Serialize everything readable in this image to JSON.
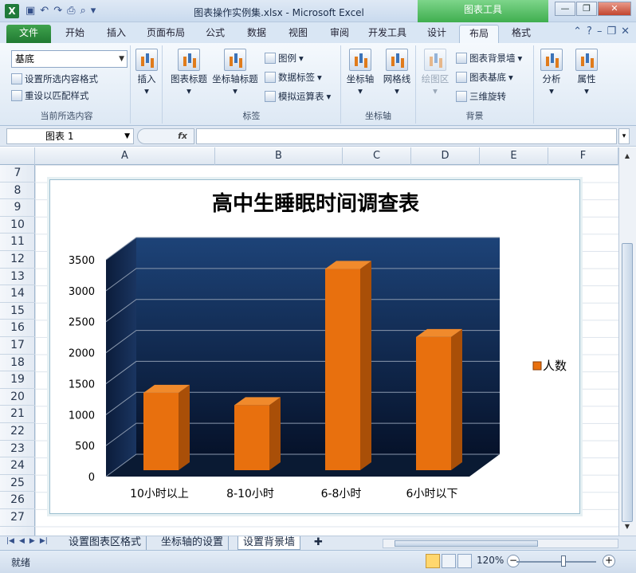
{
  "window": {
    "title": "图表操作实例集.xlsx - Microsoft Excel",
    "context_tab": "图表工具",
    "app_letter": "X"
  },
  "tabs": [
    "文件",
    "开始",
    "插入",
    "页面布局",
    "公式",
    "数据",
    "视图",
    "审阅",
    "开发工具",
    "设计",
    "布局",
    "格式"
  ],
  "active_tab": "布局",
  "ribbon": {
    "current_selection": {
      "combo": "基底",
      "format_selection": "设置所选内容格式",
      "reset_style": "重设以匹配样式",
      "label": "当前所选内容"
    },
    "insert": {
      "label": "插入"
    },
    "labels": {
      "chart_title": "图表标题",
      "axis_title": "坐标轴标题",
      "legend": "图例",
      "data_labels": "数据标签",
      "data_table": "模拟运算表",
      "label": "标签"
    },
    "axes": {
      "axes": "坐标轴",
      "gridlines": "网格线",
      "label": "坐标轴"
    },
    "background": {
      "plot_area": "绘图区",
      "chart_wall": "图表背景墙",
      "chart_floor": "图表基底",
      "rotation": "三维旋转",
      "label": "背景"
    },
    "analysis": {
      "label": "分析"
    },
    "properties": {
      "label": "属性"
    }
  },
  "formula_bar": {
    "name_box": "图表 1",
    "fx": "fx"
  },
  "columns": [
    "A",
    "B",
    "C",
    "D",
    "E",
    "F"
  ],
  "rows": [
    "7",
    "8",
    "9",
    "10",
    "11",
    "12",
    "13",
    "14",
    "15",
    "16",
    "17",
    "18",
    "19",
    "20",
    "21",
    "22",
    "23",
    "24",
    "25",
    "26",
    "27"
  ],
  "chart_data": {
    "type": "bar",
    "title": "高中生睡眠时间调查表",
    "categories": [
      "10小时以上",
      "8-10小时",
      "6-8小时",
      "6小时以下"
    ],
    "series": [
      {
        "name": "人数",
        "values": [
          1250,
          1050,
          3250,
          2150
        ],
        "color": "#e8700e"
      }
    ],
    "ylim": [
      0,
      3500
    ],
    "yticks": [
      "0",
      "500",
      "1000",
      "1500",
      "2000",
      "2500",
      "3000",
      "3500"
    ],
    "grid": true,
    "legend_position": "right",
    "wall_color": "#17375e"
  },
  "sheet_tabs": [
    "设置图表区格式",
    "坐标轴的设置",
    "设置背景墙"
  ],
  "active_sheet": "设置背景墙",
  "status": {
    "ready": "就绪",
    "zoom": "120%"
  }
}
